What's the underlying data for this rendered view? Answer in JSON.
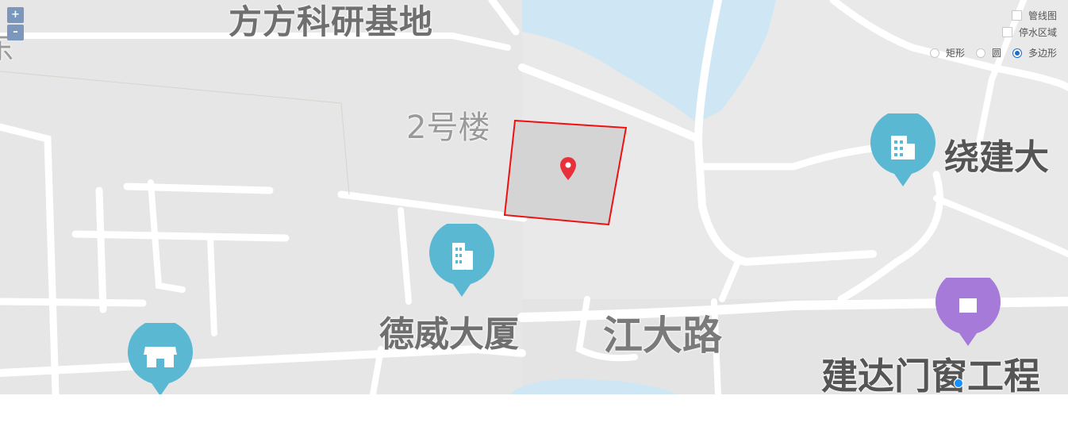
{
  "map": {
    "labels": {
      "base": "方方科研基地",
      "bldg2": "2号楼",
      "dewei": "德威大厦",
      "jiangda": "江大路",
      "raojian": "绕建大",
      "jianda": "建达门窗工程",
      "edge": "东"
    },
    "colors": {
      "water": "#cfe7f5",
      "poi_teal": "#5bb8d3",
      "poi_purple": "#a57ad8",
      "polygon_stroke": "#ee1111",
      "polygon_fill": "#d4d4d4",
      "marker": "#e8303a"
    },
    "icons": {
      "marker": "map-marker-icon",
      "building": "building-icon",
      "shop": "shop-icon"
    }
  },
  "zoom": {
    "in_label": "+",
    "out_label": "–"
  },
  "layers": {
    "pipeline_label": "管线图",
    "outage_label": "停水区域"
  },
  "draw_modes": {
    "rect_label": "矩形",
    "circle_label": "圆",
    "polygon_label": "多边形",
    "selected": "polygon"
  }
}
